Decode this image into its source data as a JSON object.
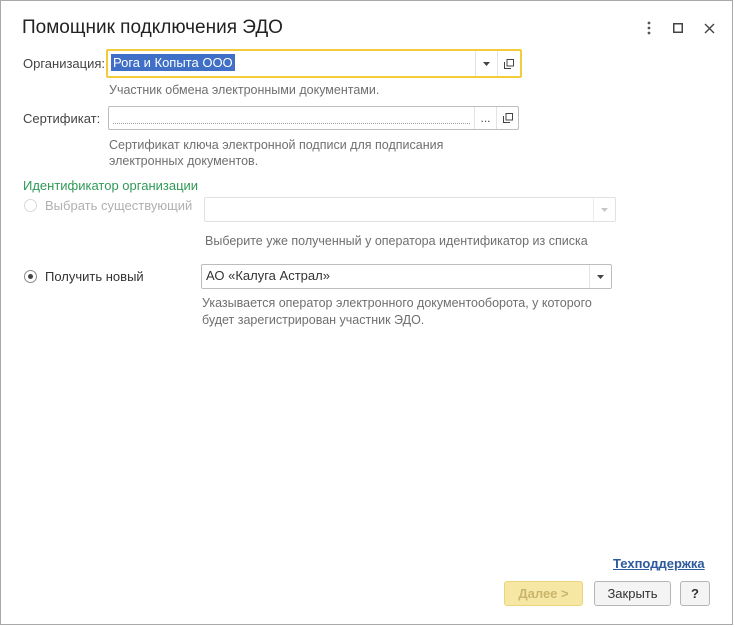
{
  "window": {
    "title": "Помощник подключения ЭДО"
  },
  "organization": {
    "label": "Организация:",
    "value": "Рога и Копыта ООО",
    "hint": "Участник обмена электронными документами."
  },
  "certificate": {
    "label": "Сертификат:",
    "value": "",
    "select_symbol": "...",
    "hint_line1": "Сертификат ключа электронной подписи для подписания",
    "hint_line2": "электронных документов."
  },
  "identifier": {
    "section_title": "Идентификатор организации",
    "existing": {
      "label": "Выбрать существующий",
      "value": "",
      "hint": "Выберите уже полученный у оператора идентификатор из списка",
      "selected": false,
      "enabled": false
    },
    "new": {
      "label": "Получить новый",
      "value": "АО «Калуга Астрал»",
      "hint_line1": "Указывается оператор электронного документооборота, у которого",
      "hint_line2": "будет зарегистрирован участник ЭДО.",
      "selected": true
    }
  },
  "footer": {
    "support_link": "Техподдержка",
    "next_button": "Далее >",
    "close_button": "Закрыть",
    "help_button": "?"
  },
  "colors": {
    "focus_border": "#f2cc3b",
    "section_title": "#2f9a57",
    "selection": "#3f6fc7",
    "link": "#2c5a9c",
    "next_button_bg": "#f7e7a4"
  }
}
